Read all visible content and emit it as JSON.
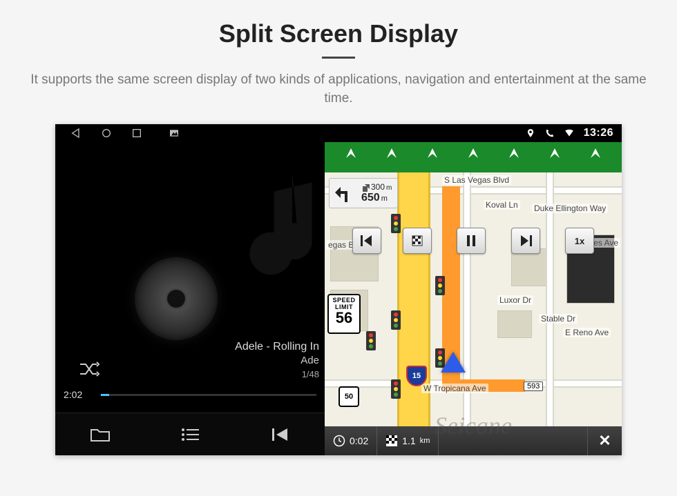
{
  "heading": "Split Screen Display",
  "subheading": "It supports the same screen display of two kinds of applications, navigation and entertainment at the same time.",
  "statusbar": {
    "clock": "13:26"
  },
  "music": {
    "track_title": "Adele - Rolling In",
    "artist": "Ade",
    "track_index": "1/48",
    "elapsed": "2:02"
  },
  "navigation": {
    "turn_distance_upcoming": "300",
    "turn_distance_upcoming_unit": "m",
    "turn_distance_current": "650",
    "turn_distance_current_unit": "m",
    "speed_limit_label": "SPEED LIMIT",
    "speed_limit_value": "56",
    "speed_button": "1x",
    "streets": {
      "top": "S Las Vegas Blvd",
      "bottom": "W Tropicana Ave",
      "right1": "Koval Ln",
      "right2": "Duke Ellington Way",
      "right3": "Luxor Dr",
      "right4": "Stable Dr",
      "right5": "E Reno Ave",
      "right6": "iles Ave",
      "left1": "egas Blvd"
    },
    "shields": {
      "us": "50",
      "interstate": "15"
    },
    "exit": "593",
    "bottom": {
      "time": "0:02",
      "distance": "1.1",
      "distance_unit": "km"
    }
  },
  "watermark": "Seicane"
}
